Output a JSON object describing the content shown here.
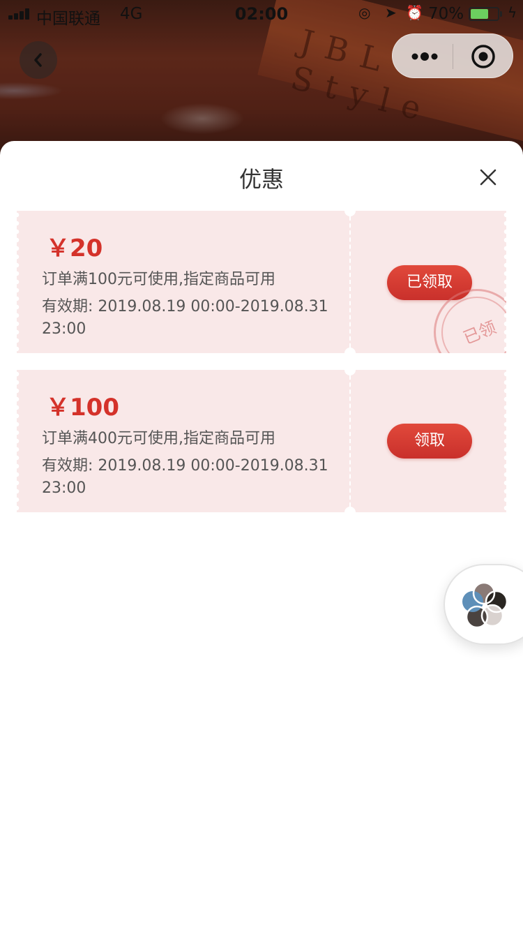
{
  "status_bar": {
    "carrier": "中国联通",
    "network": "4G",
    "time": "02:00",
    "battery_percent": "70%",
    "battery_level": 0.7,
    "battery_color": "#6ccf5f"
  },
  "background": {
    "brand_text": "JBL Style"
  },
  "nav": {
    "back_icon": "chevron-left-icon",
    "more_icon": "more-dots-icon",
    "close_icon": "target-circle-icon"
  },
  "sheet": {
    "title": "优惠",
    "close_icon": "close-x-icon"
  },
  "coupons": [
    {
      "amount": "￥20",
      "condition": "订单满100元可使用,指定商品可用",
      "validity": "有效期: 2019.08.19 00:00-2019.08.31 23:00",
      "button_label": "已领取",
      "stamp_text": "已领"
    },
    {
      "amount": "￥100",
      "condition": "订单满400元可使用,指定商品可用",
      "validity": "有效期: 2019.08.19 00:00-2019.08.31 23:00",
      "button_label": "领取"
    }
  ],
  "colors": {
    "accent_red": "#d4322a",
    "coupon_bg": "#f9e8e8",
    "button_red": "#c9302b"
  },
  "float_button": {
    "icon": "petal-logo-icon"
  }
}
